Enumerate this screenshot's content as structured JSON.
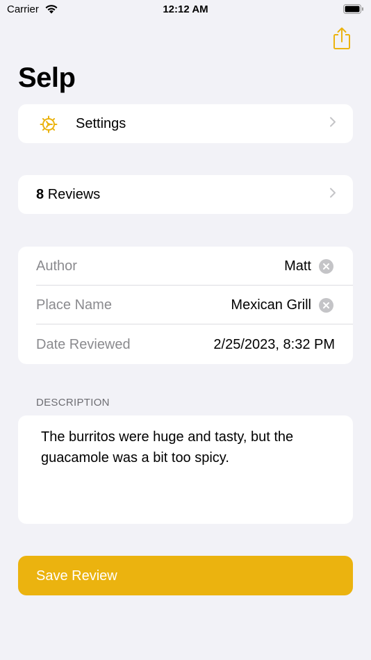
{
  "status_bar": {
    "carrier": "Carrier",
    "time": "12:12 AM"
  },
  "header": {
    "title": "Selp"
  },
  "settings": {
    "label": "Settings",
    "icon": "gear-icon"
  },
  "reviews": {
    "count": "8",
    "label": "Reviews"
  },
  "form": {
    "author": {
      "label": "Author",
      "value": "Matt"
    },
    "place": {
      "label": "Place Name",
      "value": "Mexican Grill"
    },
    "date": {
      "label": "Date Reviewed",
      "value": "2/25/2023, 8:32 PM"
    }
  },
  "description": {
    "header": "DESCRIPTION",
    "text": "The burritos were huge and tasty, but the guacamole was a bit too spicy."
  },
  "save": {
    "label": "Save Review"
  },
  "colors": {
    "accent": "#ebb30f",
    "background": "#f2f2f7"
  }
}
